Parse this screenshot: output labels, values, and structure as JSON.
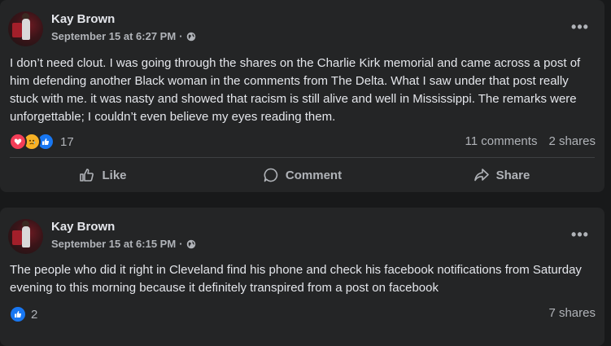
{
  "posts": [
    {
      "author": "Kay Brown",
      "timestamp": "September 15 at 6:27 PM",
      "separator": "·",
      "privacy_icon": "globe-icon",
      "more_label": "•••",
      "text": "I don’t need clout. I was going through the shares on the Charlie Kirk memorial and came across a post of him defending another Black woman in the comments from The Delta. What I saw under that post really stuck with me. it was nasty and showed that racism is still alive and well in Mississippi. The remarks were unforgettable; I couldn’t even believe my eyes reading them.",
      "reactions": [
        "love-icon",
        "sad-icon",
        "like-icon"
      ],
      "reaction_count": "17",
      "comments": "11 comments",
      "shares": "2 shares",
      "actions": {
        "like": "Like",
        "comment": "Comment",
        "share": "Share"
      }
    },
    {
      "author": "Kay Brown",
      "timestamp": "September 15 at 6:15 PM",
      "separator": "·",
      "privacy_icon": "globe-icon",
      "more_label": "•••",
      "text": "The people who did it right in Cleveland find his phone and check his facebook notifications from Saturday evening to this morning because it definitely transpired from a post on facebook",
      "reactions": [
        "like-icon"
      ],
      "reaction_count": "2",
      "shares": "7 shares"
    }
  ],
  "colors": {
    "background": "#18191a",
    "card": "#242526",
    "primary_text": "#e4e6eb",
    "secondary_text": "#b0b3b8",
    "like_blue": "#1877f2",
    "love_red": "#f33e58",
    "sad_yellow": "#f7b125"
  }
}
